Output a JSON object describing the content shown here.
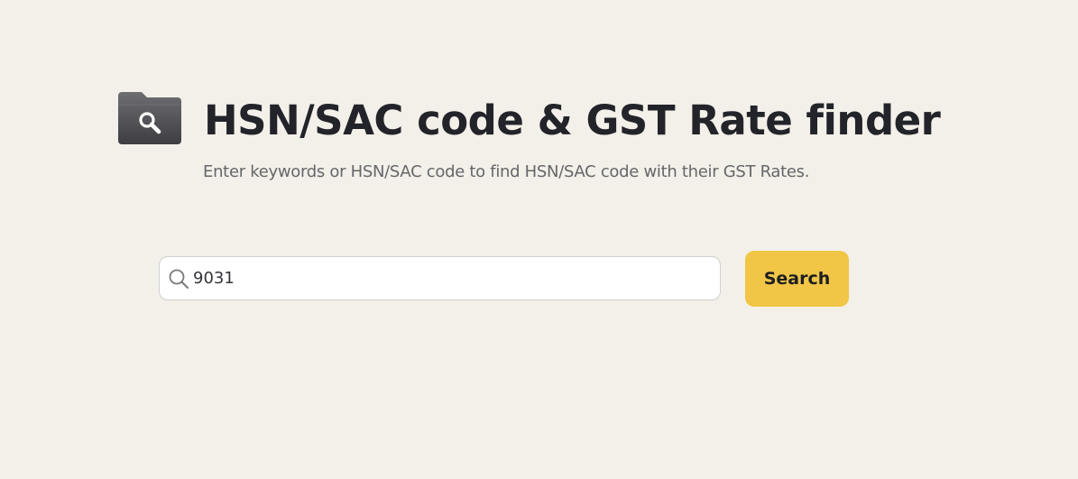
{
  "header": {
    "icon": "folder-search-icon",
    "title": "HSN/SAC code & GST Rate finder",
    "subtitle": "Enter keywords or HSN/SAC code to find HSN/SAC code with their GST Rates."
  },
  "search": {
    "icon": "search-icon",
    "value": "9031",
    "button_label": "Search"
  },
  "colors": {
    "background": "#f3f0e9",
    "button": "#f1c646",
    "title": "#23232a",
    "subtitle": "#66666a",
    "icon_folder": "#5a5a5e"
  }
}
